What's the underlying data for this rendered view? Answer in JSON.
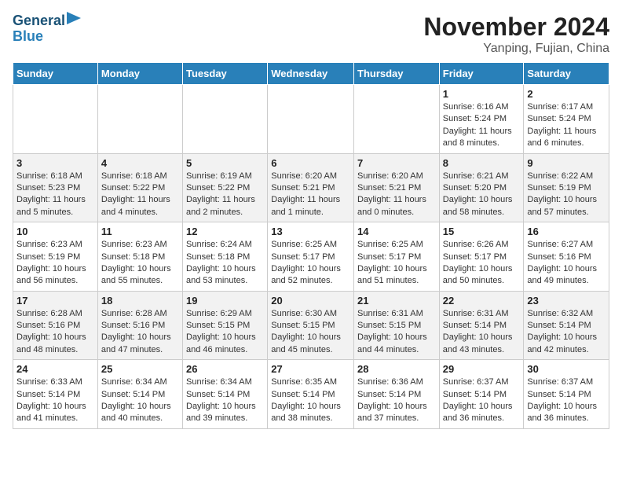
{
  "logo": {
    "line1": "General",
    "line2": "Blue"
  },
  "title": "November 2024",
  "subtitle": "Yanping, Fujian, China",
  "weekdays": [
    "Sunday",
    "Monday",
    "Tuesday",
    "Wednesday",
    "Thursday",
    "Friday",
    "Saturday"
  ],
  "weeks": [
    [
      {
        "day": "",
        "info": ""
      },
      {
        "day": "",
        "info": ""
      },
      {
        "day": "",
        "info": ""
      },
      {
        "day": "",
        "info": ""
      },
      {
        "day": "",
        "info": ""
      },
      {
        "day": "1",
        "info": "Sunrise: 6:16 AM\nSunset: 5:24 PM\nDaylight: 11 hours and 8 minutes."
      },
      {
        "day": "2",
        "info": "Sunrise: 6:17 AM\nSunset: 5:24 PM\nDaylight: 11 hours and 6 minutes."
      }
    ],
    [
      {
        "day": "3",
        "info": "Sunrise: 6:18 AM\nSunset: 5:23 PM\nDaylight: 11 hours and 5 minutes."
      },
      {
        "day": "4",
        "info": "Sunrise: 6:18 AM\nSunset: 5:22 PM\nDaylight: 11 hours and 4 minutes."
      },
      {
        "day": "5",
        "info": "Sunrise: 6:19 AM\nSunset: 5:22 PM\nDaylight: 11 hours and 2 minutes."
      },
      {
        "day": "6",
        "info": "Sunrise: 6:20 AM\nSunset: 5:21 PM\nDaylight: 11 hours and 1 minute."
      },
      {
        "day": "7",
        "info": "Sunrise: 6:20 AM\nSunset: 5:21 PM\nDaylight: 11 hours and 0 minutes."
      },
      {
        "day": "8",
        "info": "Sunrise: 6:21 AM\nSunset: 5:20 PM\nDaylight: 10 hours and 58 minutes."
      },
      {
        "day": "9",
        "info": "Sunrise: 6:22 AM\nSunset: 5:19 PM\nDaylight: 10 hours and 57 minutes."
      }
    ],
    [
      {
        "day": "10",
        "info": "Sunrise: 6:23 AM\nSunset: 5:19 PM\nDaylight: 10 hours and 56 minutes."
      },
      {
        "day": "11",
        "info": "Sunrise: 6:23 AM\nSunset: 5:18 PM\nDaylight: 10 hours and 55 minutes."
      },
      {
        "day": "12",
        "info": "Sunrise: 6:24 AM\nSunset: 5:18 PM\nDaylight: 10 hours and 53 minutes."
      },
      {
        "day": "13",
        "info": "Sunrise: 6:25 AM\nSunset: 5:17 PM\nDaylight: 10 hours and 52 minutes."
      },
      {
        "day": "14",
        "info": "Sunrise: 6:25 AM\nSunset: 5:17 PM\nDaylight: 10 hours and 51 minutes."
      },
      {
        "day": "15",
        "info": "Sunrise: 6:26 AM\nSunset: 5:17 PM\nDaylight: 10 hours and 50 minutes."
      },
      {
        "day": "16",
        "info": "Sunrise: 6:27 AM\nSunset: 5:16 PM\nDaylight: 10 hours and 49 minutes."
      }
    ],
    [
      {
        "day": "17",
        "info": "Sunrise: 6:28 AM\nSunset: 5:16 PM\nDaylight: 10 hours and 48 minutes."
      },
      {
        "day": "18",
        "info": "Sunrise: 6:28 AM\nSunset: 5:16 PM\nDaylight: 10 hours and 47 minutes."
      },
      {
        "day": "19",
        "info": "Sunrise: 6:29 AM\nSunset: 5:15 PM\nDaylight: 10 hours and 46 minutes."
      },
      {
        "day": "20",
        "info": "Sunrise: 6:30 AM\nSunset: 5:15 PM\nDaylight: 10 hours and 45 minutes."
      },
      {
        "day": "21",
        "info": "Sunrise: 6:31 AM\nSunset: 5:15 PM\nDaylight: 10 hours and 44 minutes."
      },
      {
        "day": "22",
        "info": "Sunrise: 6:31 AM\nSunset: 5:14 PM\nDaylight: 10 hours and 43 minutes."
      },
      {
        "day": "23",
        "info": "Sunrise: 6:32 AM\nSunset: 5:14 PM\nDaylight: 10 hours and 42 minutes."
      }
    ],
    [
      {
        "day": "24",
        "info": "Sunrise: 6:33 AM\nSunset: 5:14 PM\nDaylight: 10 hours and 41 minutes."
      },
      {
        "day": "25",
        "info": "Sunrise: 6:34 AM\nSunset: 5:14 PM\nDaylight: 10 hours and 40 minutes."
      },
      {
        "day": "26",
        "info": "Sunrise: 6:34 AM\nSunset: 5:14 PM\nDaylight: 10 hours and 39 minutes."
      },
      {
        "day": "27",
        "info": "Sunrise: 6:35 AM\nSunset: 5:14 PM\nDaylight: 10 hours and 38 minutes."
      },
      {
        "day": "28",
        "info": "Sunrise: 6:36 AM\nSunset: 5:14 PM\nDaylight: 10 hours and 37 minutes."
      },
      {
        "day": "29",
        "info": "Sunrise: 6:37 AM\nSunset: 5:14 PM\nDaylight: 10 hours and 36 minutes."
      },
      {
        "day": "30",
        "info": "Sunrise: 6:37 AM\nSunset: 5:14 PM\nDaylight: 10 hours and 36 minutes."
      }
    ]
  ]
}
